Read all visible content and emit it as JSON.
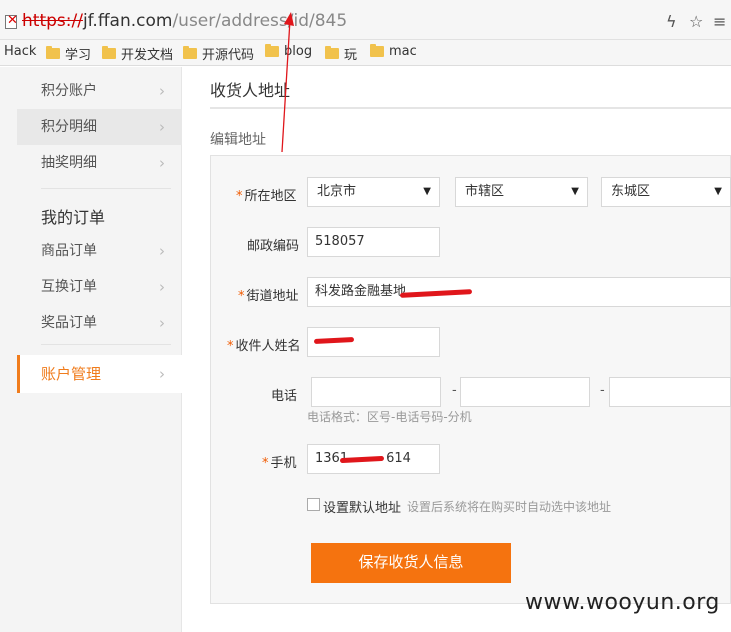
{
  "browser": {
    "url_scheme": "https://",
    "url_host": "jf.ffan.com",
    "url_path": "/user/address/id/845",
    "bookmarks": [
      "Hack",
      "学习",
      "开发文档",
      "开源代码",
      "blog",
      "玩",
      "mac"
    ]
  },
  "sidebar": {
    "items_top": [
      "积分账户",
      "积分明细",
      "抽奖明细"
    ],
    "orders_heading": "我的订单",
    "items_orders": [
      "商品订单",
      "互换订单",
      "奖品订单"
    ],
    "account": "账户管理",
    "chevron": "›"
  },
  "main": {
    "title": "收货人地址",
    "subtitle": "编辑地址"
  },
  "form": {
    "region_label": "所在地区",
    "region_province": "北京市",
    "region_city": "市辖区",
    "region_district": "东城区",
    "zip_label": "邮政编码",
    "zip_value": "518057",
    "street_label": "街道地址",
    "street_value": "科发路金融基地",
    "name_label": "收件人姓名",
    "name_value": "",
    "phone_label": "电话",
    "phone_dash": "-",
    "phone_hint": "电话格式：区号-电话号码-分机",
    "mobile_label": "手机",
    "mobile_value_start": "1361",
    "mobile_value_end": "614",
    "default_label": "设置默认地址",
    "default_hint": "设置后系统将在购买时自动选中该地址",
    "save_label": "保存收货人信息",
    "required_mark": "*"
  },
  "watermark": "www.wooyun.org",
  "colors": {
    "accent": "#f5730f",
    "required": "#f05a00",
    "redaction": "#e0161b"
  }
}
